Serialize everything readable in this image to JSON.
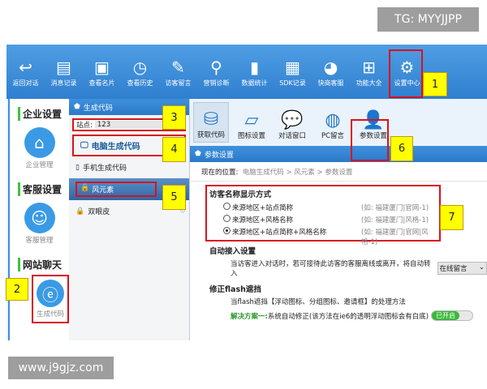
{
  "watermarks": {
    "top": "TG: MYYJJPP",
    "bottom": "www.j9gjz.com"
  },
  "toolbar": [
    {
      "label": "返回对话",
      "icon": "back-arrow-icon"
    },
    {
      "label": "消息记录",
      "icon": "message-icon"
    },
    {
      "label": "查看名片",
      "icon": "card-icon"
    },
    {
      "label": "查看历史",
      "icon": "clock-icon"
    },
    {
      "label": "访客留言",
      "icon": "edit-icon"
    },
    {
      "label": "营销诊断",
      "icon": "diagnosis-icon"
    },
    {
      "label": "数据统计",
      "icon": "bar-chart-icon"
    },
    {
      "label": "SDK记录",
      "icon": "clipboard-icon"
    },
    {
      "label": "快商客服",
      "icon": "headset-icon"
    },
    {
      "label": "功能大全",
      "icon": "grid-icon"
    },
    {
      "label": "设置中心",
      "icon": "gear-icon"
    }
  ],
  "sidebar": {
    "sections": [
      {
        "title": "企业设置",
        "item": "企业管理",
        "icon": "home-icon"
      },
      {
        "title": "客服设置",
        "item": "客服管理",
        "icon": "agent-icon"
      },
      {
        "title": "网站聊天",
        "item": "生成代码",
        "icon": "browser-icon"
      }
    ]
  },
  "middle": {
    "header": "生成代码",
    "site_label": "站点:",
    "site_value": "123",
    "items": [
      "电脑生成代码",
      "手机生成代码"
    ],
    "styles": [
      "风元素",
      "双眼皮"
    ]
  },
  "right": {
    "tabs": [
      "获取代码",
      "图标设置",
      "对话窗口",
      "PC留言",
      "参数设置"
    ],
    "panel_title": "参数设置",
    "breadcrumb_label": "现在的位置:",
    "breadcrumb": "电脑生成代码 > 风元素 > 参数设置",
    "name_display": {
      "title": "访客名称显示方式",
      "options": [
        {
          "label": "来源地区+站点简称",
          "example": "(如: 福建厦门|官网-1)",
          "selected": false
        },
        {
          "label": "来源地区+风格名称",
          "example": "(如: 福建厦门|风格-1)",
          "selected": false
        },
        {
          "label": "来源地区+站点简称+风格名称",
          "example": "(如: 福建厦门|官网|风格-1)",
          "selected": true
        }
      ]
    },
    "auto": {
      "title": "自动接入设置",
      "text": "当访客进入对话时，若可接待此访客的客服离线或离开，将自动转入",
      "select": "在线留言"
    },
    "flash": {
      "title": "修正flash遮挡",
      "text": "当flash遮挡【浮动图标、分组图标、邀请框】的处理方法",
      "solution_label": "解决方案一:",
      "solution_text": "系统自动修正(该方法在ie6的透明浮动图标会有白底)",
      "toggle": "已开启",
      "toggle_on": true
    }
  },
  "annotations": [
    "1",
    "2",
    "3",
    "4",
    "5",
    "6",
    "7"
  ],
  "colors": {
    "toolbar": "#3a8ad8",
    "highlight": "#d8121c",
    "tag": "#ffff00",
    "green": "#2a9a2a"
  }
}
